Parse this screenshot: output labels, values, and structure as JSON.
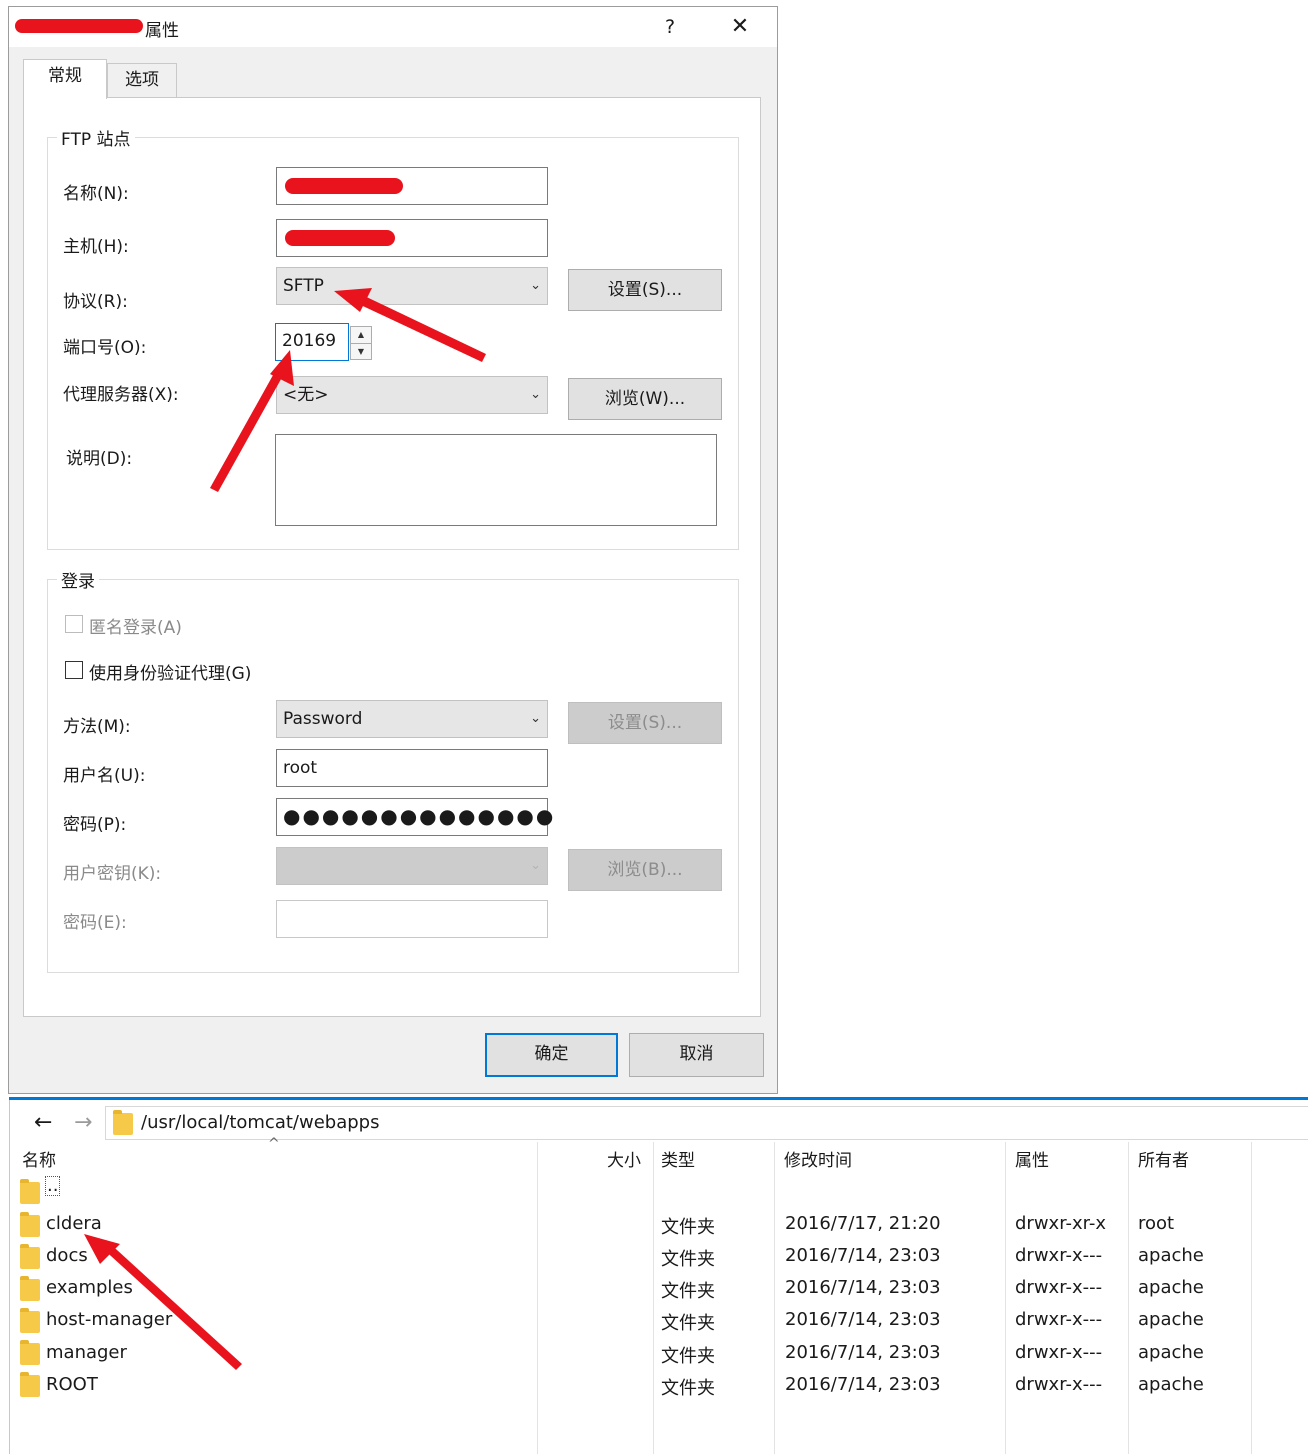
{
  "dialog": {
    "title_suffix": "属性",
    "help_label": "?",
    "close_label": "✕",
    "tabs": {
      "general": "常规",
      "options": "选项"
    },
    "ftp_site": {
      "group_title": "FTP 站点",
      "name_label": "名称(N):",
      "host_label": "主机(H):",
      "protocol_label": "协议(R):",
      "protocol_value": "SFTP",
      "settings_button": "设置(S)...",
      "port_label": "端口号(O):",
      "port_value": "20169",
      "proxy_label": "代理服务器(X):",
      "proxy_value": "<无>",
      "browse_button": "浏览(W)...",
      "description_label": "说明(D):"
    },
    "login": {
      "group_title": "登录",
      "anonymous_label": "匿名登录(A)",
      "agent_label": "使用身份验证代理(G)",
      "method_label": "方法(M):",
      "method_value": "Password",
      "method_settings_button": "设置(S)...",
      "username_label": "用户名(U):",
      "username_value": "root",
      "password_label": "密码(P):",
      "password_value": "●●●●●●●●●●●●●●",
      "userkey_label": "用户密钥(K):",
      "userkey_browse_button": "浏览(B)...",
      "passphrase_label": "密码(E):"
    },
    "ok_button": "确定",
    "cancel_button": "取消"
  },
  "file_pane": {
    "back_icon": "←",
    "forward_icon": "→",
    "path": "/usr/local/tomcat/webapps",
    "columns": {
      "name": "名称",
      "size": "大小",
      "type": "类型",
      "modified": "修改时间",
      "attributes": "属性",
      "owner": "所有者"
    },
    "parent_entry": "..",
    "rows": [
      {
        "name": "cldera",
        "type": "文件夹",
        "modified": "2016/7/17, 21:20",
        "attributes": "drwxr-xr-x",
        "owner": "root"
      },
      {
        "name": "docs",
        "type": "文件夹",
        "modified": "2016/7/14, 23:03",
        "attributes": "drwxr-x---",
        "owner": "apache"
      },
      {
        "name": "examples",
        "type": "文件夹",
        "modified": "2016/7/14, 23:03",
        "attributes": "drwxr-x---",
        "owner": "apache"
      },
      {
        "name": "host-manager",
        "type": "文件夹",
        "modified": "2016/7/14, 23:03",
        "attributes": "drwxr-x---",
        "owner": "apache"
      },
      {
        "name": "manager",
        "type": "文件夹",
        "modified": "2016/7/14, 23:03",
        "attributes": "drwxr-x---",
        "owner": "apache"
      },
      {
        "name": "ROOT",
        "type": "文件夹",
        "modified": "2016/7/14, 23:03",
        "attributes": "drwxr-x---",
        "owner": "apache"
      }
    ]
  },
  "colors": {
    "accent": "#0078d7",
    "annotation_arrow": "#e8131c",
    "folder": "#f7c948"
  }
}
